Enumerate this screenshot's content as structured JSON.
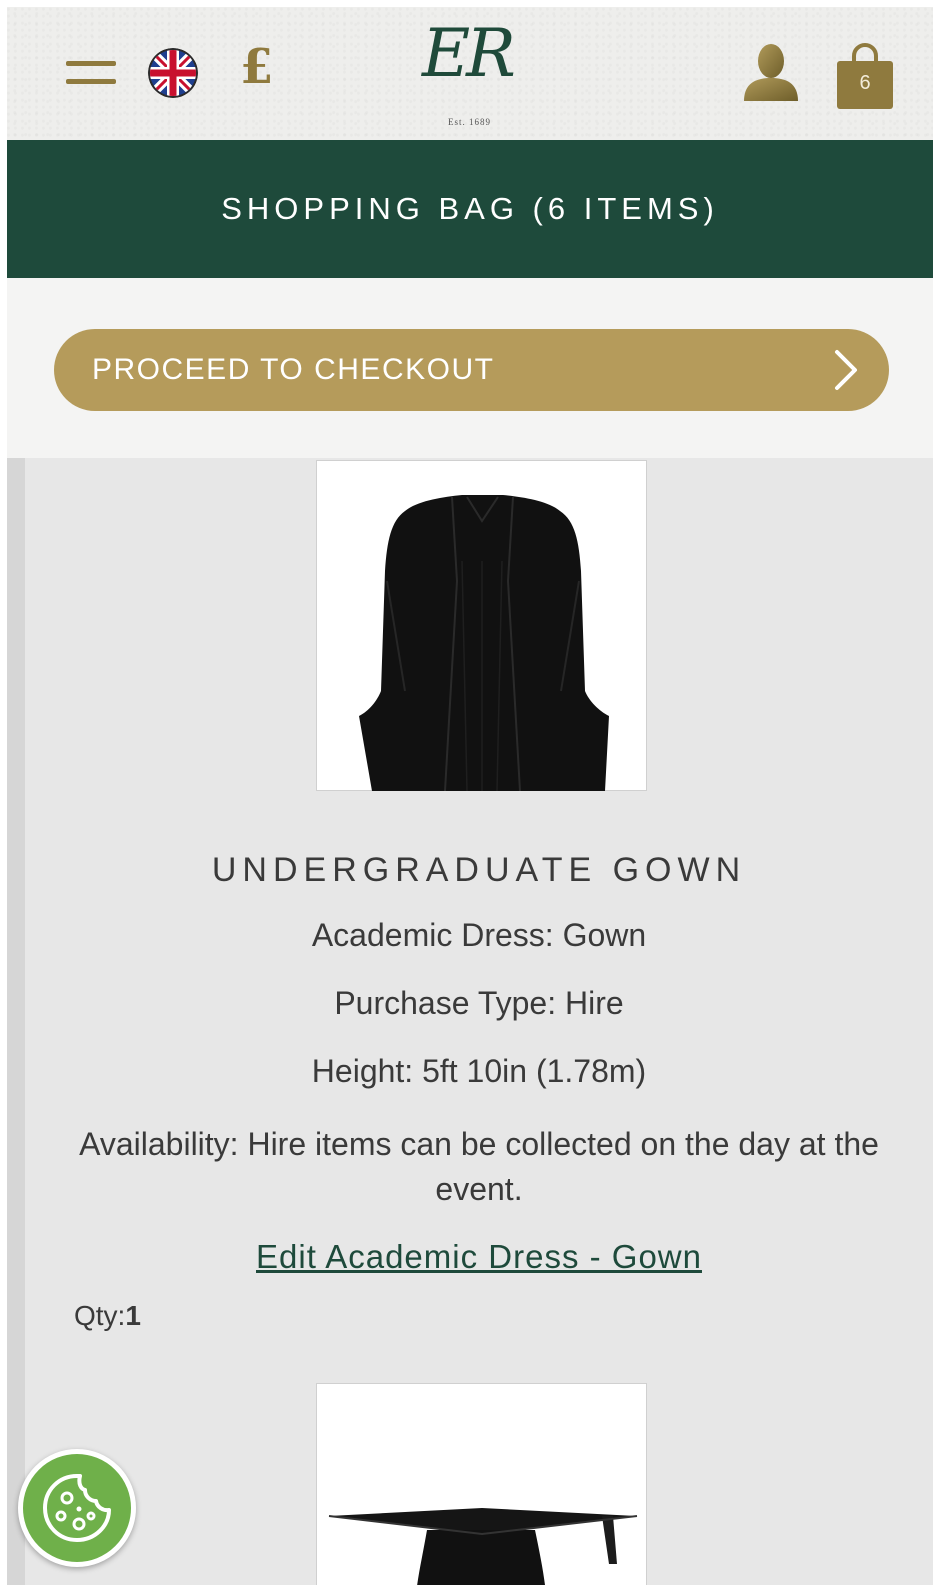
{
  "header": {
    "menu_icon": "hamburger-icon",
    "flag_icon": "uk-flag-icon",
    "currency_symbol": "£",
    "logo_text": "ER",
    "logo_est": "Est. 1689",
    "account_icon": "user-icon",
    "bag_icon": "shopping-bag-icon",
    "bag_count": "6"
  },
  "title": "SHOPPING BAG (6 ITEMS)",
  "checkout": {
    "label": "PROCEED TO CHECKOUT",
    "icon": "chevron-right-icon"
  },
  "items": [
    {
      "name": "UNDERGRADUATE GOWN",
      "attributes": [
        "Academic Dress: Gown",
        "Purchase Type: Hire",
        "Height: 5ft 10in (1.78m)",
        "Availability: Hire items can be collected on the day at the event."
      ],
      "edit_label": "Edit Academic Dress - Gown",
      "qty_label": "Qty:",
      "qty_value": "1"
    }
  ],
  "cookie_icon": "cookie-icon",
  "colors": {
    "brand_green": "#1e4a3b",
    "gold": "#b59b5b",
    "gold_dark": "#8f7a3e",
    "cookie_green": "#6fb04a"
  }
}
